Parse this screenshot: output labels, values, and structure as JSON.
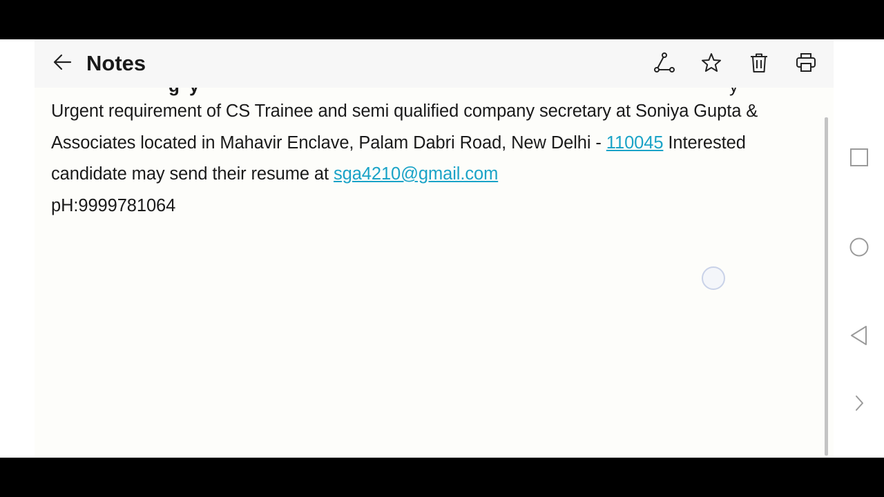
{
  "toolbar": {
    "title": "Notes",
    "icons": [
      "back-arrow-icon",
      "share-icon",
      "star-icon",
      "trash-icon",
      "print-icon"
    ]
  },
  "note": {
    "partial_line": "… g y …",
    "line1_text": "Urgent requirement of CS Trainee and semi qualified company secretary at Soniya Gupta & Associates located in Mahavir Enclave, Palam Dabri Road, New Delhi - ",
    "pin_link": "110045",
    "line2_text": " Interested candidate may send their resume at ",
    "email_link": "sga4210@gmail.com",
    "phone": "pH:9999781064"
  },
  "navbar": {
    "icons": [
      "recents-square-icon",
      "home-circle-icon",
      "back-triangle-icon",
      "expand-chevron-icon"
    ]
  },
  "colors": {
    "link": "#1aa3c7",
    "text": "#1a1a1a",
    "toolbar_bg": "#f7f7f7",
    "note_bg": "#fdfdfa"
  }
}
